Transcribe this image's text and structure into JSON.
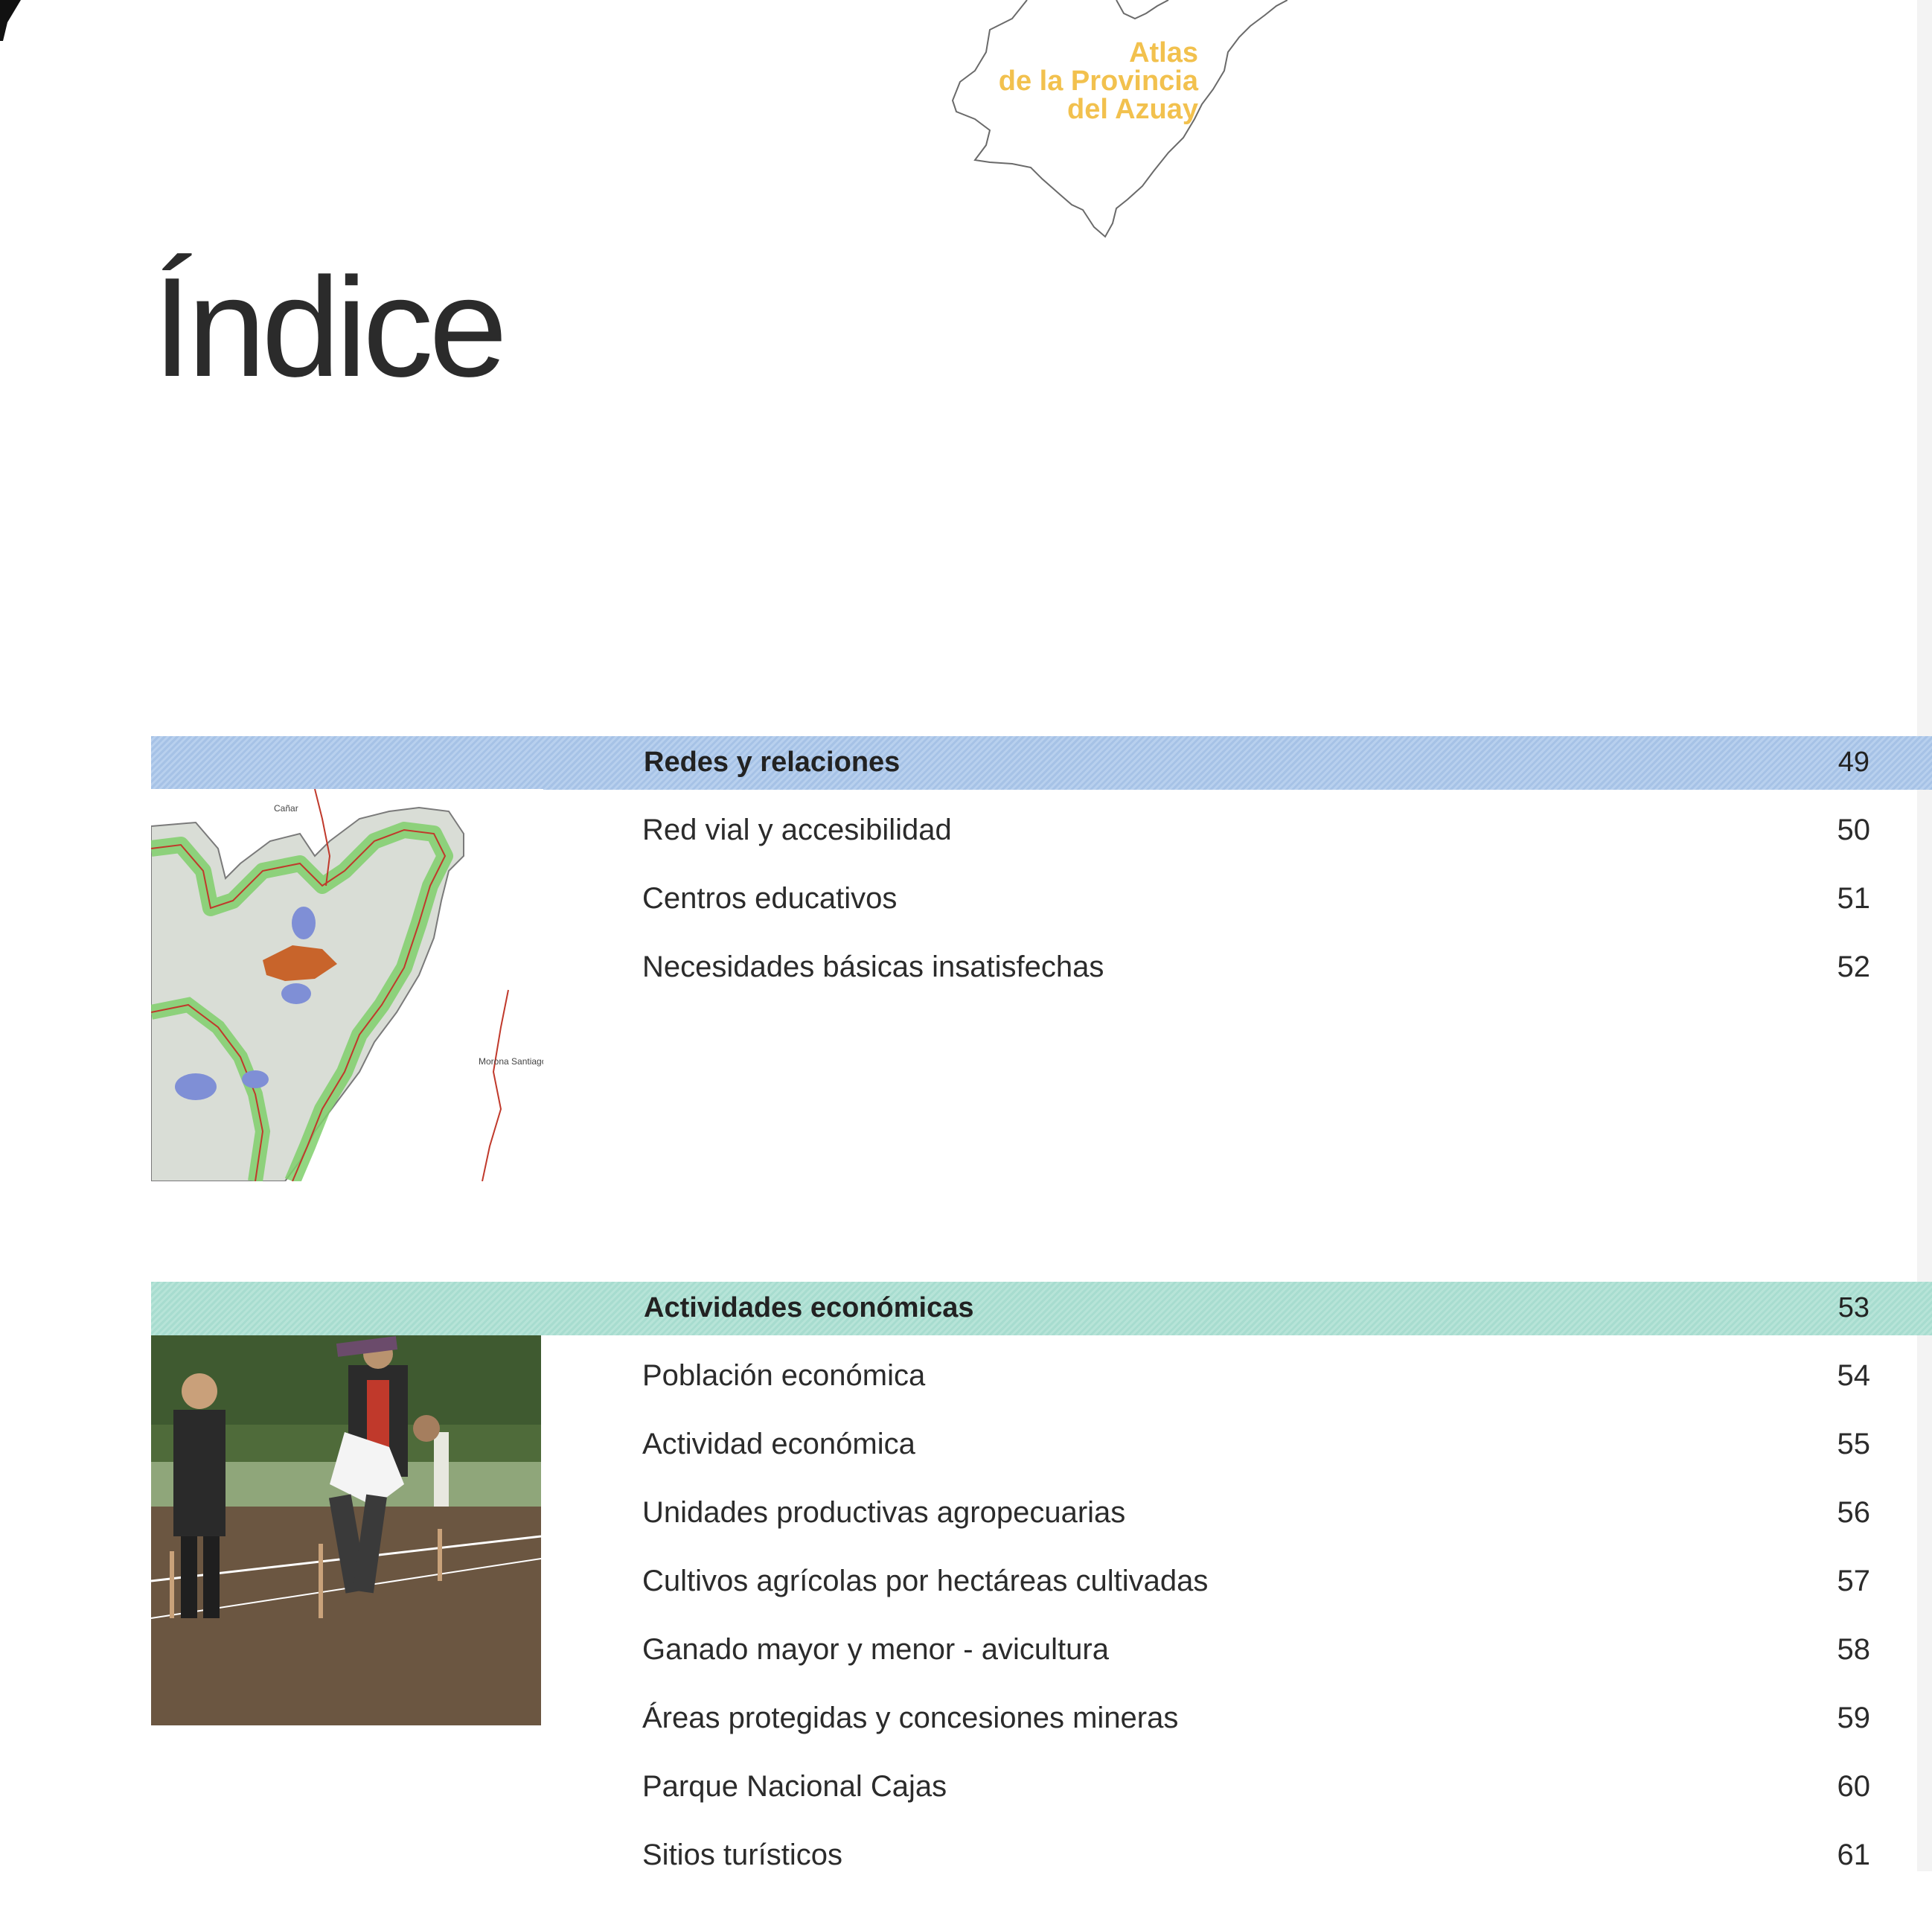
{
  "header": {
    "atlas_lines": [
      "Atlas",
      "de la Provincia",
      "del Azuay"
    ]
  },
  "page_title": "Índice",
  "sections": [
    {
      "title": "Redes y relaciones",
      "page": "49",
      "items": [
        {
          "label": "Red vial y accesibilidad",
          "page": "50"
        },
        {
          "label": "Centros educativos",
          "page": "51"
        },
        {
          "label": "Necesidades básicas insatisfechas",
          "page": "52"
        }
      ]
    },
    {
      "title": "Actividades económicas",
      "page": "53",
      "items": [
        {
          "label": "Población económica",
          "page": "54"
        },
        {
          "label": "Actividad económica",
          "page": "55"
        },
        {
          "label": "Unidades productivas agropecuarias",
          "page": "56"
        },
        {
          "label": "Cultivos agrícolas por hectáreas cultivadas",
          "page": "57"
        },
        {
          "label": "Ganado mayor y menor - avicultura",
          "page": "58"
        },
        {
          "label": "Áreas protegidas y concesiones mineras",
          "page": "59"
        },
        {
          "label": "Parque Nacional Cajas",
          "page": "60"
        },
        {
          "label": "Sitios turísticos",
          "page": "61"
        }
      ]
    }
  ],
  "map_labels": {
    "canar": "Cañar",
    "morona": "Morona Santiago"
  },
  "colors": {
    "atlas_yellow": "#f2c14e",
    "band_blue": "#b0c9ea",
    "band_green": "#afe0d3",
    "title_text": "#2b2b2b"
  }
}
